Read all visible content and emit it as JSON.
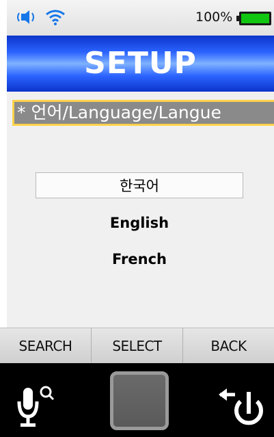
{
  "status_bar": {
    "battery_percent": "100%",
    "icons": [
      "sound-icon",
      "wifi-icon",
      "battery-icon"
    ],
    "battery_color": "#11c611"
  },
  "header": {
    "title": "SETUP",
    "accent_color": "#2c64ff"
  },
  "language_setting": {
    "label": "* 언어/Language/Langue",
    "options": [
      {
        "label": "한국어",
        "selected": true
      },
      {
        "label": "English",
        "selected": false
      },
      {
        "label": "French",
        "selected": false
      }
    ]
  },
  "softkeys": [
    {
      "label": "SEARCH"
    },
    {
      "label": "SELECT"
    },
    {
      "label": "BACK"
    }
  ],
  "hardware": {
    "icons": [
      "microphone-search-icon",
      "home-button",
      "back-power-icon"
    ]
  }
}
